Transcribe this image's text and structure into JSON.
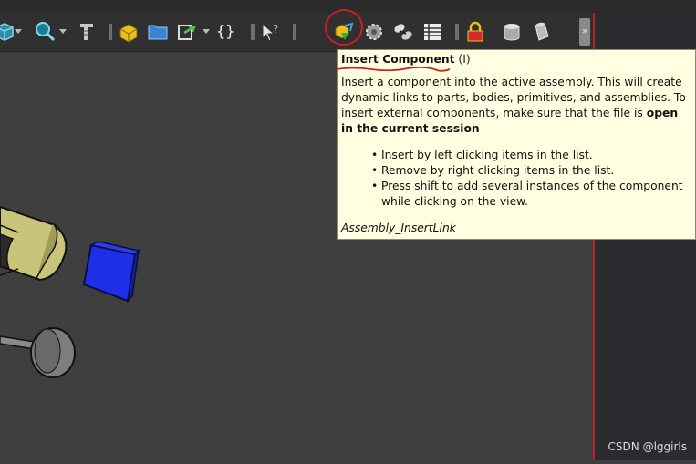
{
  "toolbar": {
    "icons": [
      {
        "name": "view-cube-icon"
      },
      {
        "name": "zoom-icon"
      },
      {
        "name": "measure-icon"
      },
      {
        "name": "new-assembly-icon"
      },
      {
        "name": "folder-icon"
      },
      {
        "name": "export-icon"
      },
      {
        "name": "json-braces-icon"
      },
      {
        "name": "whats-this-icon"
      },
      {
        "name": "insert-component-icon"
      },
      {
        "name": "gear-part-icon"
      },
      {
        "name": "constraints-icon"
      },
      {
        "name": "bill-of-materials-icon"
      },
      {
        "name": "lock-icon"
      },
      {
        "name": "database-icon"
      },
      {
        "name": "cylinder-icon"
      }
    ],
    "braces_label": "{}",
    "overflow_label": "»"
  },
  "tooltip": {
    "title": "Insert Component",
    "shortcut": "(I)",
    "description_part1": "Insert a component into the active assembly. This will create dynamic links to parts, bodies, primitives, and assemblies. To insert external components, make sure that the file is ",
    "description_bold": "open in the current session",
    "bullets": [
      "Insert by left clicking items in the list.",
      "Remove by right clicking items in the list.",
      "Press shift to add several instances of the component while clicking on the view."
    ],
    "command_name": "Assembly_InsertLink"
  },
  "watermark": "CSDN @lggirls",
  "colors": {
    "toolbar_bg": "#303030",
    "viewport_bg": "#3f3f3f",
    "tooltip_bg": "#ffffe1",
    "annotation_red": "#d11e1e",
    "cube_blue": "#1f2fe8",
    "tube_yellow": "#c9c47a"
  }
}
